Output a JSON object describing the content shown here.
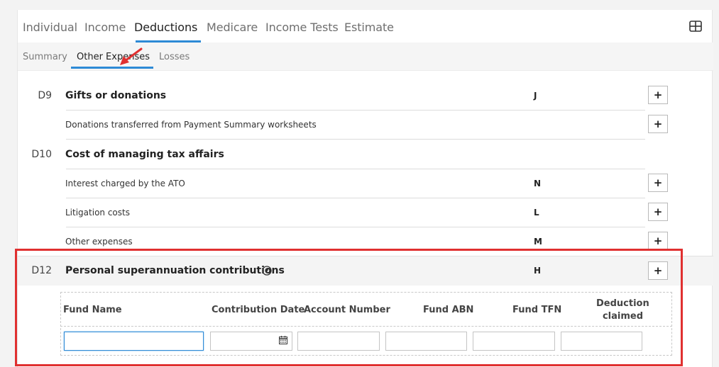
{
  "top_tabs": [
    {
      "label": "Individual"
    },
    {
      "label": "Income"
    },
    {
      "label": "Deductions"
    },
    {
      "label": "Medicare"
    },
    {
      "label": "Income Tests"
    },
    {
      "label": "Estimate"
    }
  ],
  "active_top_tab": "Deductions",
  "sub_tabs": [
    {
      "label": "Summary"
    },
    {
      "label": "Other Expenses"
    },
    {
      "label": "Losses"
    }
  ],
  "active_sub_tab": "Other Expenses",
  "rows": {
    "d9": {
      "code": "D9",
      "title": "Gifts or donations",
      "label": "J"
    },
    "d9_sub": {
      "text": "Donations transferred from Payment Summary worksheets"
    },
    "d10": {
      "code": "D10",
      "title": "Cost of managing tax affairs"
    },
    "d10_interest": {
      "text": "Interest charged by the ATO",
      "label": "N"
    },
    "d10_litigation": {
      "text": "Litigation costs",
      "label": "L"
    },
    "d10_other": {
      "text": "Other expenses",
      "label": "M"
    },
    "d12": {
      "code": "D12",
      "title": "Personal superannuation contributions",
      "label": "H"
    }
  },
  "plus_label": "+",
  "super_table": {
    "headers": {
      "fund_name": "Fund Name",
      "contribution_date": "Contribution Date",
      "account_number": "Account Number",
      "fund_abn": "Fund ABN",
      "fund_tfn": "Fund TFN",
      "deduction_line1": "Deduction",
      "deduction_line2": "claimed"
    },
    "values": {
      "fund_name": "",
      "contribution_date": "",
      "account_number": "",
      "fund_abn": "",
      "fund_tfn": "",
      "deduction_claimed": ""
    }
  },
  "icons": {
    "grid": "grid-layout-icon",
    "help": "help-circle-icon",
    "calendar": "calendar-icon",
    "annotation": "red-arrow-annotation"
  },
  "colors": {
    "accent": "#2d8ad6",
    "highlight": "#e03030"
  }
}
